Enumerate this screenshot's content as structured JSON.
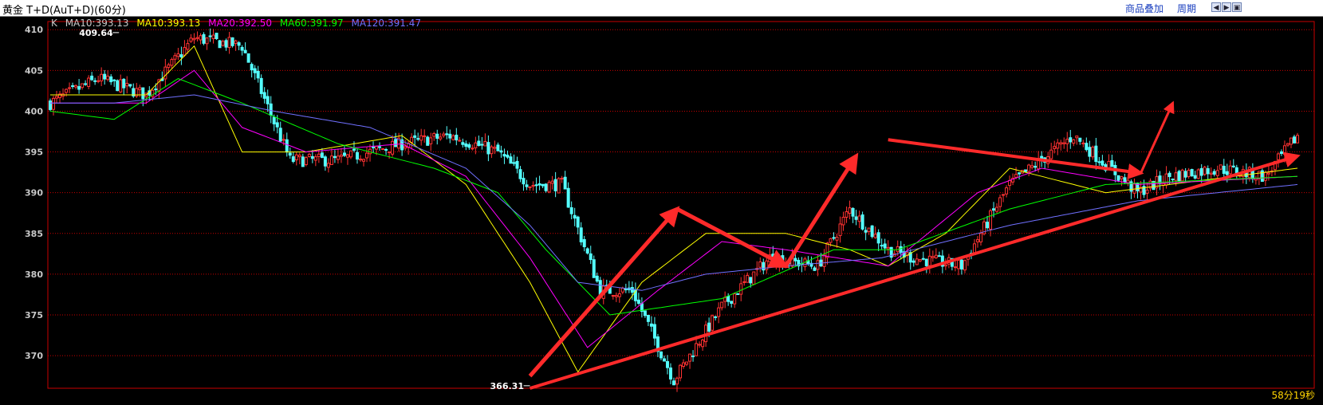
{
  "header": {
    "title": "黄金  T+D(AuT+D)(60分)",
    "overlay_label": "商品叠加",
    "period_label": "周期"
  },
  "legend": {
    "k_label": "K",
    "ma10a": "MA10:393.13",
    "ma10b": "MA10:393.13",
    "ma20": "MA20:392.50",
    "ma60": "MA60:391.97",
    "ma120": "MA120:391.47"
  },
  "annotations": {
    "high_label": "409.64",
    "low_label": "366.31"
  },
  "countdown": "58分19秒",
  "colors": {
    "up": "#ff3232",
    "down": "#54ffff",
    "ma10": "#ffff00",
    "ma20": "#ff00ff",
    "ma60": "#00ff00",
    "ma120": "#7070ff",
    "grid": "#c80000",
    "axis_text": "#c8c8c8",
    "arrow": "#ff2a2a"
  },
  "chart_data": {
    "type": "line",
    "title": "黄金 T+D(AuT+D)(60分)",
    "ylim": [
      366,
      411
    ],
    "yticks": [
      370,
      375,
      380,
      385,
      390,
      395,
      400,
      405,
      410
    ],
    "x_anchors": [
      0,
      15,
      30,
      45,
      60,
      75,
      90,
      110,
      125,
      140,
      150,
      160,
      172,
      182,
      195,
      210,
      225,
      240,
      250,
      262,
      270,
      285,
      300,
      320,
      340,
      350,
      365,
      380,
      390
    ],
    "price_path": [
      401,
      404,
      402,
      409,
      408,
      394,
      394,
      396,
      397,
      395,
      391,
      391,
      378,
      378,
      367,
      376,
      382,
      381,
      388,
      383,
      382,
      381,
      391,
      397,
      390,
      392,
      393,
      392,
      397
    ],
    "series": [
      {
        "name": "MA10",
        "anchors": [
          0,
          30,
          45,
          60,
          80,
          110,
          130,
          150,
          165,
          185,
          205,
          230,
          250,
          262,
          280,
          300,
          330,
          350,
          390
        ],
        "values": [
          402,
          402,
          408,
          395,
          395,
          397,
          391,
          379,
          368,
          379,
          385,
          385,
          383,
          381,
          385,
          393,
          390,
          391,
          393
        ]
      },
      {
        "name": "MA20",
        "anchors": [
          0,
          30,
          45,
          60,
          80,
          110,
          130,
          150,
          168,
          190,
          210,
          230,
          262,
          290,
          310,
          340,
          390
        ],
        "values": [
          401,
          401,
          405,
          398,
          395,
          396,
          392,
          382,
          371,
          378,
          384,
          383,
          381,
          390,
          393,
          391,
          392
        ]
      },
      {
        "name": "MA60",
        "anchors": [
          0,
          20,
          40,
          60,
          90,
          120,
          140,
          155,
          175,
          210,
          245,
          265,
          300,
          330,
          390
        ],
        "values": [
          400,
          399,
          404,
          401,
          396,
          393,
          390,
          383,
          375,
          377,
          383,
          383,
          388,
          391,
          392
        ]
      },
      {
        "name": "MA120",
        "anchors": [
          0,
          20,
          45,
          70,
          100,
          130,
          150,
          165,
          185,
          205,
          230,
          260,
          300,
          340,
          390
        ],
        "values": [
          401,
          401,
          402,
          400,
          398,
          393,
          386,
          379,
          378,
          380,
          381,
          382,
          386,
          389,
          391
        ]
      }
    ],
    "high": 409.64,
    "low": 366.31
  }
}
